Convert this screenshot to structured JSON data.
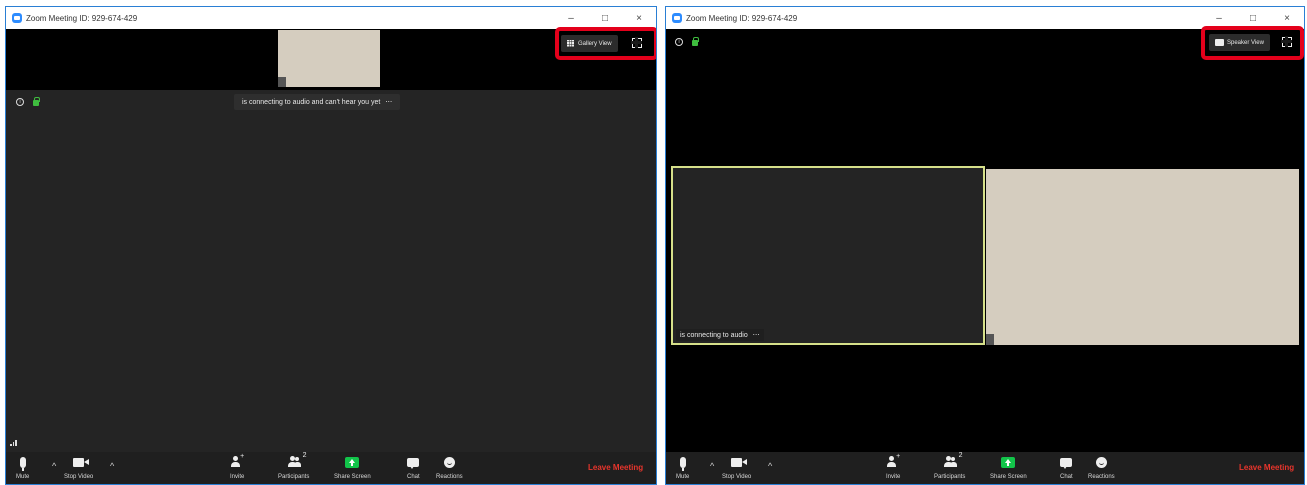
{
  "left": {
    "window_title": "Zoom Meeting ID: 929-674-429",
    "view_button": "Gallery View",
    "status_message": "is connecting to audio and can't hear you yet",
    "status_more": "⋯"
  },
  "right": {
    "window_title": "Zoom Meeting ID: 929-674-429",
    "view_button": "Speaker View",
    "tile_label": "is connecting to audio",
    "tile_more": "⋯"
  },
  "window_controls": {
    "minimize": "–",
    "maximize": "□",
    "close": "×"
  },
  "toolbar": {
    "mute": "Mute",
    "stop_video": "Stop Video",
    "invite": "Invite",
    "participants": "Participants",
    "participants_count": "2",
    "share_screen": "Share Screen",
    "chat": "Chat",
    "reactions": "Reactions",
    "leave": "Leave Meeting",
    "caret": "^"
  },
  "colors": {
    "highlight": "#e4001b",
    "active_speaker_border": "#d6e08a",
    "share_green": "#12c44a",
    "leave_red": "#e8352c",
    "zoom_blue": "#2d8cff"
  }
}
